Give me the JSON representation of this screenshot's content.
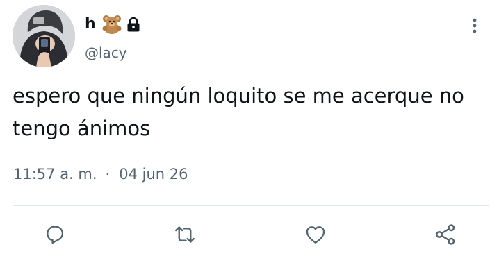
{
  "author": {
    "display_name": "h",
    "name_emojis": [
      "teddy-bear-icon",
      "lock-icon"
    ],
    "handle": "@lacy"
  },
  "tweet": {
    "text": "espero que ningún loquito se me acerque no\ntengo ánimos",
    "time": "11:57 a. m.",
    "separator": "·",
    "date": "04 jun 26"
  },
  "actions": [
    "reply-icon",
    "retweet-icon",
    "like-icon",
    "share-icon"
  ],
  "colors": {
    "text_primary": "#0f1419",
    "text_secondary": "#536471",
    "divider": "#e1e8ed"
  }
}
